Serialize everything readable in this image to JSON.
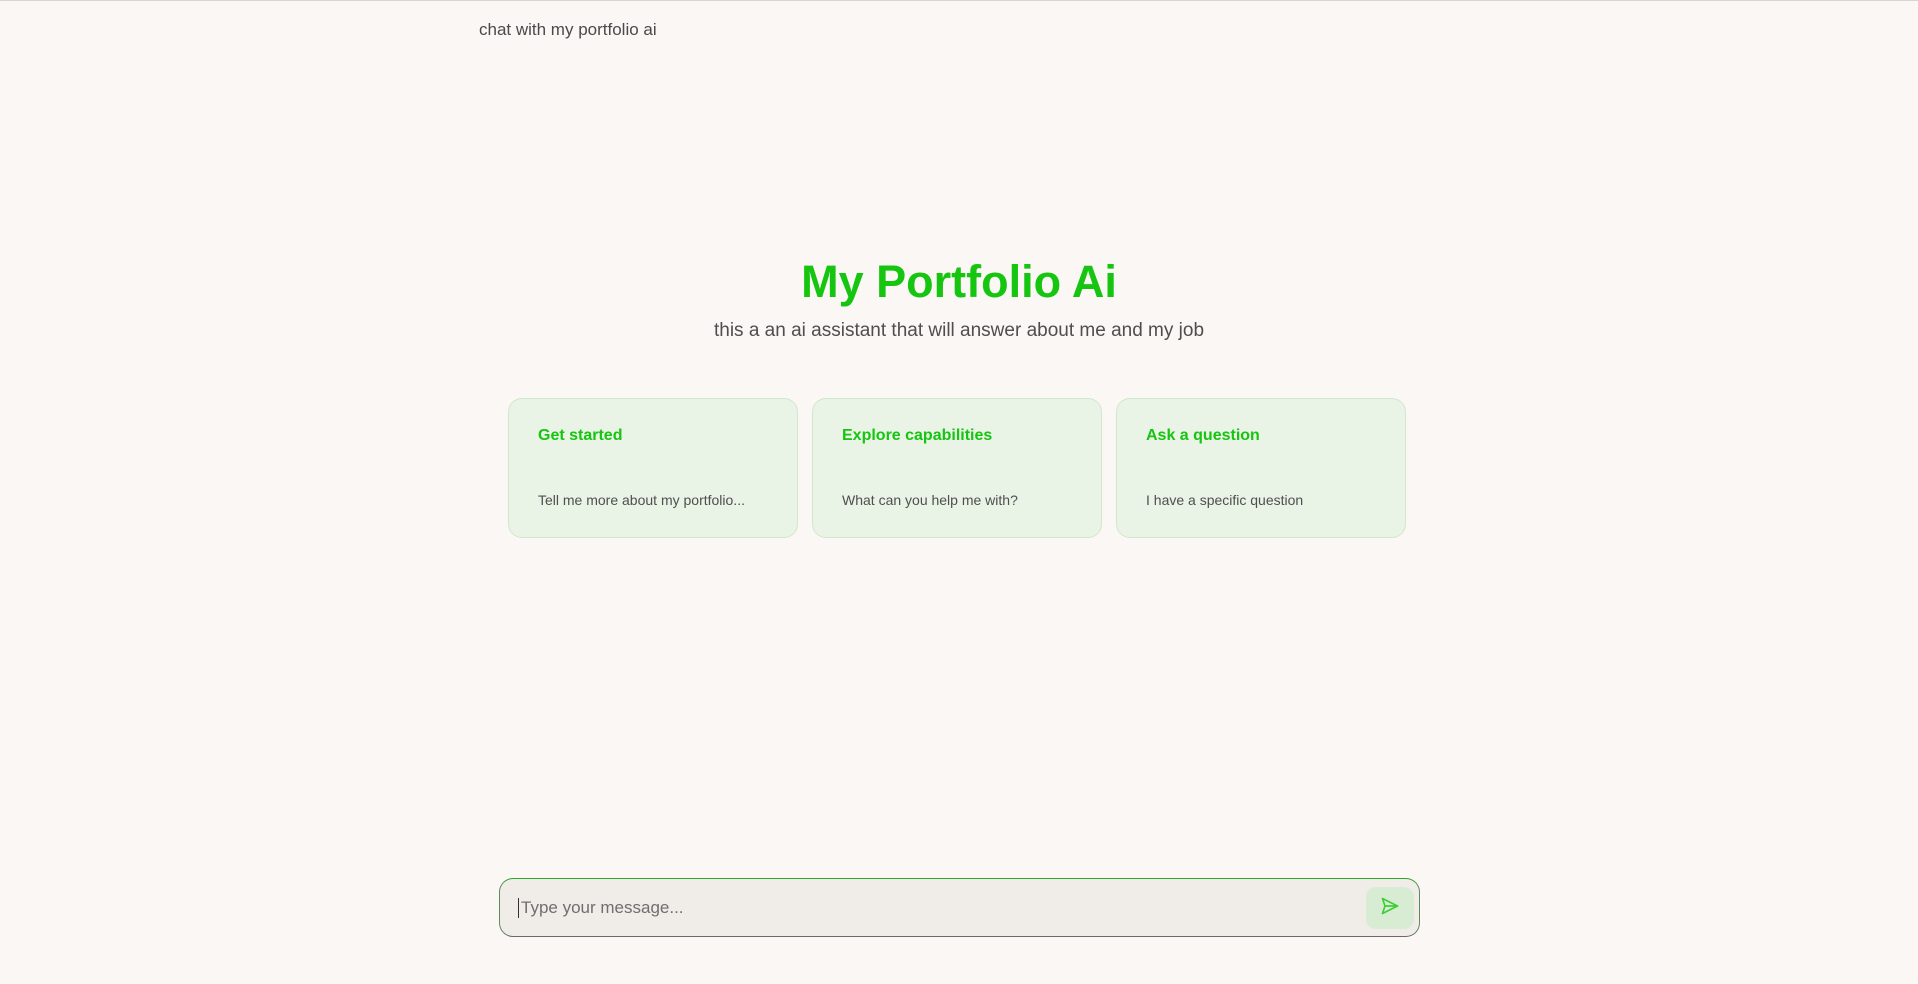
{
  "header": {
    "title": "chat with my portfolio ai"
  },
  "hero": {
    "title": "My Portfolio Ai",
    "subtitle": "this a an ai assistant that will answer about me and my job"
  },
  "cards": [
    {
      "title": "Get started",
      "description": "Tell me more about my portfolio..."
    },
    {
      "title": "Explore capabilities",
      "description": "What can you help me with?"
    },
    {
      "title": "Ask a question",
      "description": "I have a specific question"
    }
  ],
  "composer": {
    "placeholder": "Type your message...",
    "value": "",
    "send_icon": "send-icon"
  },
  "colors": {
    "accent": "#16c50f",
    "background": "#faf7f4",
    "card_background": "#e9f3e6",
    "send_background": "#d8ecd4"
  }
}
